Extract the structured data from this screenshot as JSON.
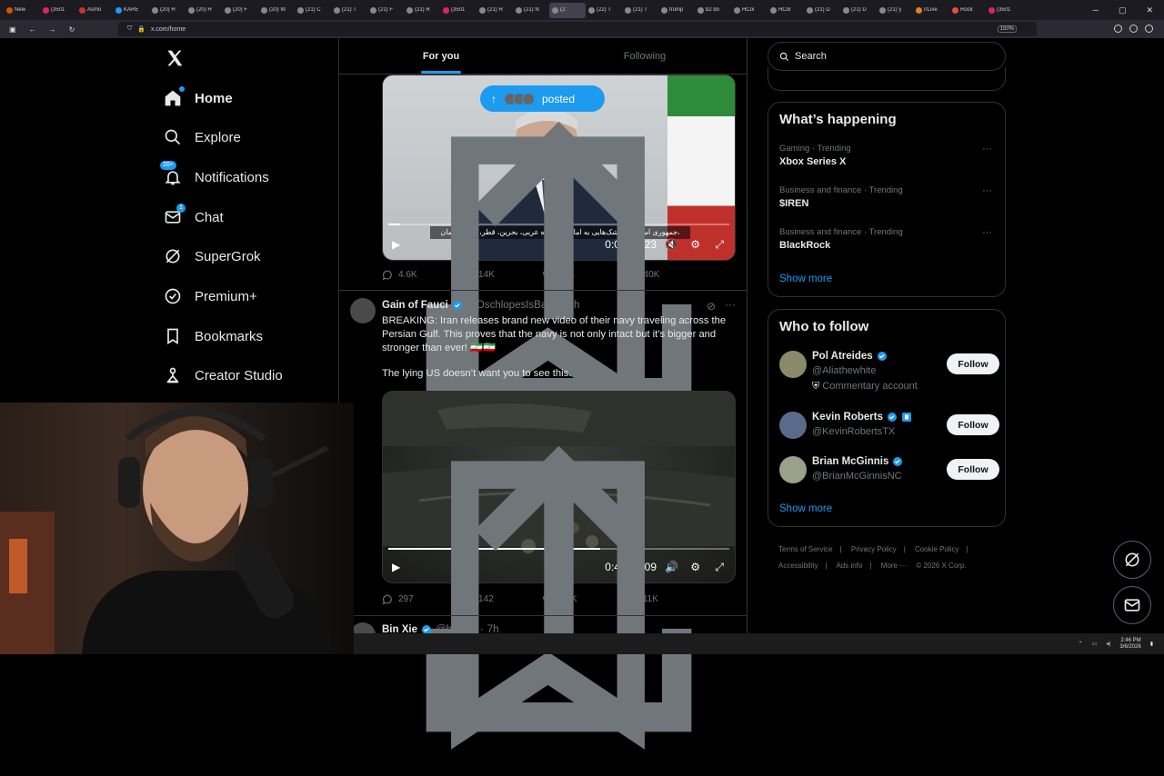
{
  "browser": {
    "tabs": [
      {
        "label": "New",
        "color": "#d35400"
      },
      {
        "label": "(3501",
        "color": "#e0245e"
      },
      {
        "label": "Asmo",
        "color": "#c0392b"
      },
      {
        "label": "KARE",
        "color": "#1d9bf0"
      },
      {
        "label": "(20) H",
        "color": "#888"
      },
      {
        "label": "(20) H",
        "color": "#888"
      },
      {
        "label": "(20) F",
        "color": "#888"
      },
      {
        "label": "(20) W",
        "color": "#888"
      },
      {
        "label": "(21) C",
        "color": "#888"
      },
      {
        "label": "(21) T",
        "color": "#888"
      },
      {
        "label": "(21) F",
        "color": "#888"
      },
      {
        "label": "(21) R",
        "color": "#888"
      },
      {
        "label": "(3501",
        "color": "#e0245e"
      },
      {
        "label": "(21) H",
        "color": "#888"
      },
      {
        "label": "(21) N",
        "color": "#888"
      },
      {
        "label": "(2:",
        "color": "#888",
        "active": true
      },
      {
        "label": "(22) T",
        "color": "#888"
      },
      {
        "label": "(21) T",
        "color": "#888"
      },
      {
        "label": "trump",
        "color": "#888"
      },
      {
        "label": "b2 bo",
        "color": "#888"
      },
      {
        "label": "HCol",
        "color": "#888"
      },
      {
        "label": "HCol",
        "color": "#888"
      },
      {
        "label": "(21) D",
        "color": "#888"
      },
      {
        "label": "(21) D",
        "color": "#888"
      },
      {
        "label": "(21) y",
        "color": "#888"
      },
      {
        "label": "r/Live",
        "color": "#e67e22"
      },
      {
        "label": "Rock",
        "color": "#e74c3c"
      },
      {
        "label": "(3501",
        "color": "#e0245e"
      }
    ],
    "url": "x.com/home",
    "zoom": "150%"
  },
  "nav": {
    "logo": "X",
    "items": [
      {
        "label": "Home",
        "icon": "home-icon"
      },
      {
        "label": "Explore",
        "icon": "search-icon"
      },
      {
        "label": "Notifications",
        "icon": "bell-icon",
        "badge": "20+"
      },
      {
        "label": "Chat",
        "icon": "mail-icon",
        "badge": "1"
      },
      {
        "label": "SuperGrok",
        "icon": "grok-icon"
      },
      {
        "label": "Premium+",
        "icon": "verified-icon"
      },
      {
        "label": "Bookmarks",
        "icon": "bookmark-icon"
      },
      {
        "label": "Creator Studio",
        "icon": "flask-icon"
      }
    ]
  },
  "feed": {
    "tabs": [
      "For you",
      "Following"
    ],
    "posted_pill": "posted",
    "video1": {
      "time": "0:09 / 4:23",
      "caption": "جمهوری اسلامی موشک‌هایی به امارات متحده عربی، بحرین، قطر، کویت، عمان،",
      "progress": 0.034
    },
    "tweet1_actions": {
      "replies": "4.6K",
      "reposts": "14K",
      "likes": "28K",
      "views": "940K"
    },
    "tweet2": {
      "name": "Gain of Fauci",
      "handle": "@DschlopesIsBack",
      "time": "4h",
      "text1": "BREAKING: Iran releases brand new video of their navy traveling across the Persian Gulf.  This proves that the navy is not only intact but it’s bigger and stronger than ever! 🇮🇷🇮🇷",
      "text2": "The lying US doesn’t want you to see this.",
      "video": {
        "time": "0:43 / 1:09",
        "progress": 0.62
      },
      "actions": {
        "replies": "297",
        "reposts": "142",
        "likes": "1.3K",
        "views": "111K"
      }
    },
    "tweet3": {
      "name": "Bin Xie",
      "handle": "@bxieus",
      "time": "7h"
    }
  },
  "sidebar": {
    "search_placeholder": "Search",
    "happening": {
      "title": "What’s happening",
      "trends": [
        {
          "category": "Gaming · Trending",
          "name": "Xbox Series X"
        },
        {
          "category": "Business and finance · Trending",
          "name": "$IREN"
        },
        {
          "category": "Business and finance · Trending",
          "name": "BlackRock"
        }
      ],
      "show_more": "Show more"
    },
    "who_to_follow": {
      "title": "Who to follow",
      "people": [
        {
          "name": "Pol Atreides",
          "handle": "@Aliathewhite",
          "extra": "Commentary account",
          "button": "Follow"
        },
        {
          "name": "Kevin Roberts",
          "handle": "@KevinRobertsTX",
          "button": "Follow"
        },
        {
          "name": "Brian McGinnis",
          "handle": "@BrianMcGinnisNC",
          "button": "Follow"
        }
      ],
      "show_more": "Show more"
    },
    "footer": [
      "Terms of Service",
      "|",
      "Privacy Policy",
      "|",
      "Cookie Policy",
      "|",
      "Accessibility",
      "|",
      "Ads info",
      "|",
      "More ···",
      "© 2026 X Corp."
    ]
  },
  "taskbar": {
    "time": "2:46 PM",
    "date": "3/6/2026"
  },
  "colors": {
    "accent": "#1d9bf0",
    "bg": "#000000",
    "muted": "#71767b",
    "border": "#2f3336"
  }
}
